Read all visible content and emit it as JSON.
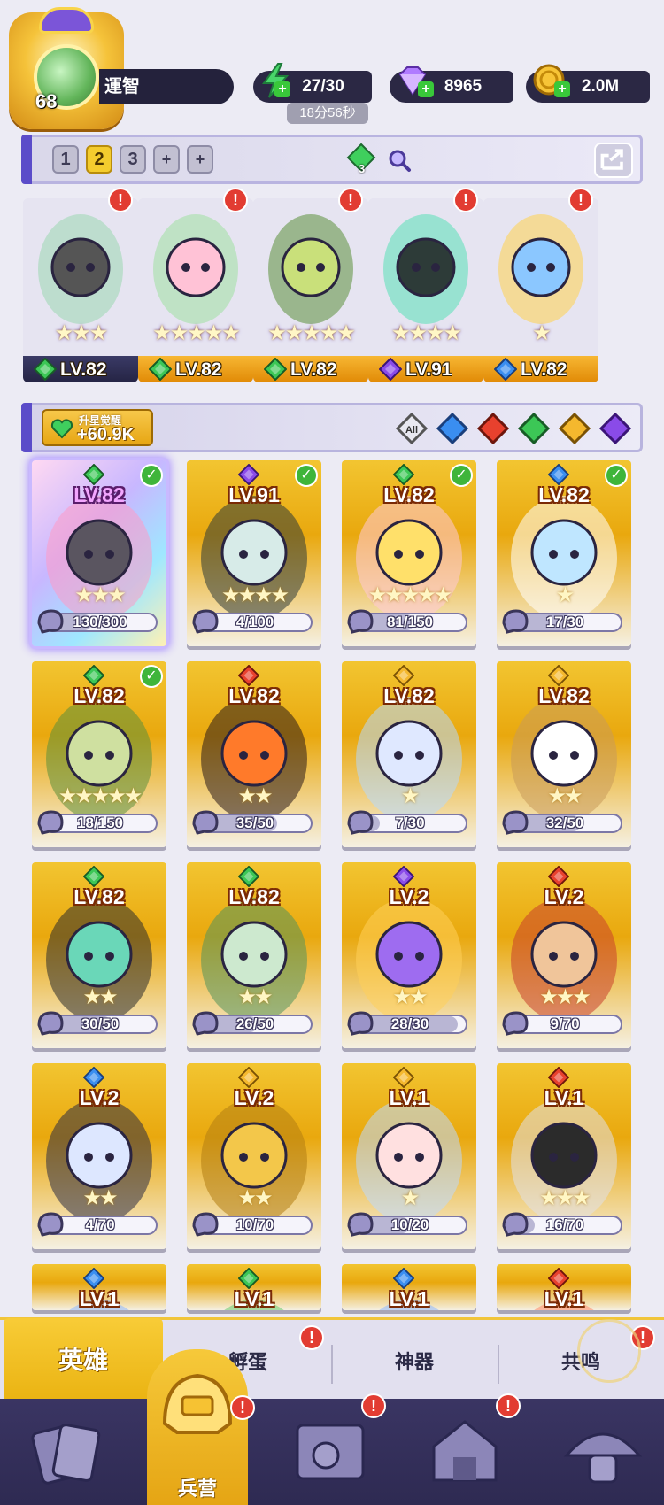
{
  "player": {
    "level": "68",
    "name": "運智"
  },
  "resources": {
    "energy": "27/30",
    "energy_timer": "18分56秒",
    "gems": "8965",
    "gold": "2.0M"
  },
  "team_tabs": {
    "tabs": [
      "1",
      "2",
      "3",
      "+",
      "+"
    ],
    "active_index": 1,
    "gem_count": "3"
  },
  "team": [
    {
      "level": "LV.82",
      "stars": "★★★",
      "element": "green",
      "bar": "purple",
      "alert": "!"
    },
    {
      "level": "LV.82",
      "stars": "★★★★★",
      "element": "green",
      "bar": "gold",
      "alert": "!"
    },
    {
      "level": "LV.82",
      "stars": "★★★★★",
      "element": "green",
      "bar": "gold",
      "alert": "!"
    },
    {
      "level": "LV.91",
      "stars": "★★★★",
      "element": "purple",
      "bar": "gold",
      "alert": "!"
    },
    {
      "level": "LV.82",
      "stars": "★",
      "element": "blue",
      "bar": "gold",
      "alert": "!"
    }
  ],
  "filter": {
    "awaken_title": "升星觉醒",
    "awaken_value": "+60.9K",
    "all_label": "All",
    "elements": [
      "water",
      "fire",
      "nature",
      "light",
      "dark"
    ]
  },
  "heroes": [
    {
      "level": "LV.82",
      "progress": "130/300",
      "fill": 0.43,
      "element": "green",
      "checked": true,
      "stars": "★★★",
      "selected": true
    },
    {
      "level": "LV.91",
      "progress": "4/100",
      "fill": 0.04,
      "element": "purple",
      "checked": true,
      "stars": "★★★★"
    },
    {
      "level": "LV.82",
      "progress": "81/150",
      "fill": 0.54,
      "element": "green",
      "checked": true,
      "stars": "★★★★★"
    },
    {
      "level": "LV.82",
      "progress": "17/30",
      "fill": 0.57,
      "element": "blue",
      "checked": true,
      "stars": "★"
    },
    {
      "level": "LV.82",
      "progress": "18/150",
      "fill": 0.12,
      "element": "green",
      "checked": true,
      "stars": "★★★★★"
    },
    {
      "level": "LV.82",
      "progress": "35/50",
      "fill": 0.7,
      "element": "red",
      "checked": false,
      "stars": "★★"
    },
    {
      "level": "LV.82",
      "progress": "7/30",
      "fill": 0.23,
      "element": "gold",
      "checked": false,
      "stars": "★"
    },
    {
      "level": "LV.82",
      "progress": "32/50",
      "fill": 0.64,
      "element": "gold",
      "checked": false,
      "stars": "★★"
    },
    {
      "level": "LV.82",
      "progress": "30/50",
      "fill": 0.6,
      "element": "green",
      "checked": false,
      "stars": "★★"
    },
    {
      "level": "LV.82",
      "progress": "26/50",
      "fill": 0.52,
      "element": "green",
      "checked": false,
      "stars": "★★"
    },
    {
      "level": "LV.2",
      "progress": "28/30",
      "fill": 0.93,
      "element": "purple",
      "checked": false,
      "stars": "★★"
    },
    {
      "level": "LV.2",
      "progress": "9/70",
      "fill": 0.13,
      "element": "red",
      "checked": false,
      "stars": "★★★"
    },
    {
      "level": "LV.2",
      "progress": "4/70",
      "fill": 0.06,
      "element": "blue",
      "checked": false,
      "stars": "★★"
    },
    {
      "level": "LV.2",
      "progress": "10/70",
      "fill": 0.14,
      "element": "gold",
      "checked": false,
      "stars": "★★"
    },
    {
      "level": "LV.1",
      "progress": "10/20",
      "fill": 0.5,
      "element": "gold",
      "checked": false,
      "stars": "★"
    },
    {
      "level": "LV.1",
      "progress": "16/70",
      "fill": 0.23,
      "element": "red",
      "checked": false,
      "stars": "★★★"
    },
    {
      "level": "LV.1",
      "progress": "",
      "fill": 0,
      "element": "blue",
      "checked": false,
      "stars": ""
    },
    {
      "level": "LV.1",
      "progress": "",
      "fill": 0,
      "element": "green",
      "checked": false,
      "stars": ""
    },
    {
      "level": "LV.1",
      "progress": "",
      "fill": 0,
      "element": "blue",
      "checked": false,
      "stars": ""
    },
    {
      "level": "LV.1",
      "progress": "",
      "fill": 0,
      "element": "red",
      "checked": false,
      "stars": ""
    }
  ],
  "subtabs": {
    "heroes": "英雄",
    "hatch": "孵蛋",
    "artifact": "神器",
    "resonance": "共鸣",
    "alert": "!"
  },
  "bottomnav": {
    "barracks": "兵营",
    "alert": "!"
  },
  "colors": {
    "gold": "#f4c12e",
    "purple_accent": "#5b4cc9",
    "alert_red": "#e23c32"
  }
}
